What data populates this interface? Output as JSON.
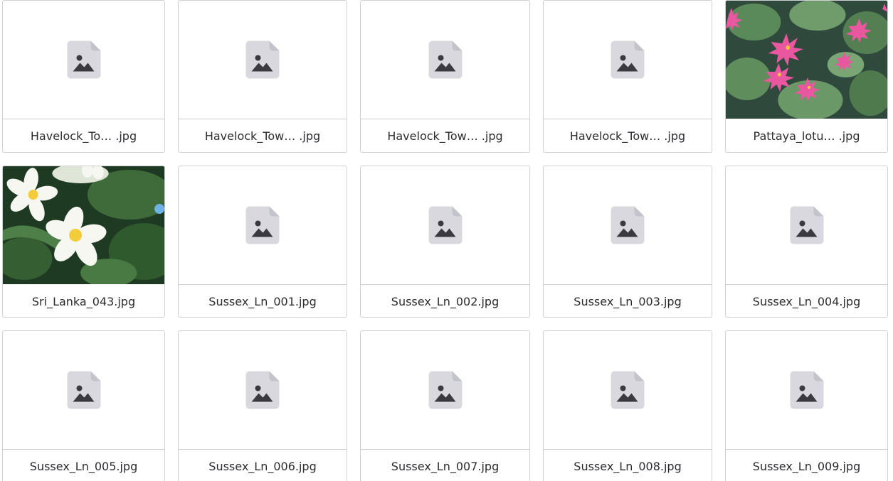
{
  "files": [
    {
      "name": "Havelock_To…  .jpg",
      "thumbnail": "file-image-placeholder"
    },
    {
      "name": "Havelock_Tow… .jpg",
      "thumbnail": "file-image-placeholder"
    },
    {
      "name": "Havelock_Tow… .jpg",
      "thumbnail": "file-image-placeholder"
    },
    {
      "name": "Havelock_Tow… .jpg",
      "thumbnail": "file-image-placeholder"
    },
    {
      "name": "Pattaya_lotu… .jpg",
      "thumbnail": "photo-pink-water-lilies"
    },
    {
      "name": "Sri_Lanka_043.jpg",
      "thumbnail": "photo-white-frangipani"
    },
    {
      "name": "Sussex_Ln_001.jpg",
      "thumbnail": "file-image-placeholder"
    },
    {
      "name": "Sussex_Ln_002.jpg",
      "thumbnail": "file-image-placeholder"
    },
    {
      "name": "Sussex_Ln_003.jpg",
      "thumbnail": "file-image-placeholder"
    },
    {
      "name": "Sussex_Ln_004.jpg",
      "thumbnail": "file-image-placeholder"
    },
    {
      "name": "Sussex_Ln_005.jpg",
      "thumbnail": "file-image-placeholder"
    },
    {
      "name": "Sussex_Ln_006.jpg",
      "thumbnail": "file-image-placeholder"
    },
    {
      "name": "Sussex_Ln_007.jpg",
      "thumbnail": "file-image-placeholder"
    },
    {
      "name": "Sussex_Ln_008.jpg",
      "thumbnail": "file-image-placeholder"
    },
    {
      "name": "Sussex_Ln_009.jpg",
      "thumbnail": "file-image-placeholder"
    }
  ],
  "colors": {
    "border": "#cfcfd4",
    "icon_fill": "#d8d8de",
    "icon_glyph": "#3a3a40",
    "label_text": "#2b2b30"
  }
}
